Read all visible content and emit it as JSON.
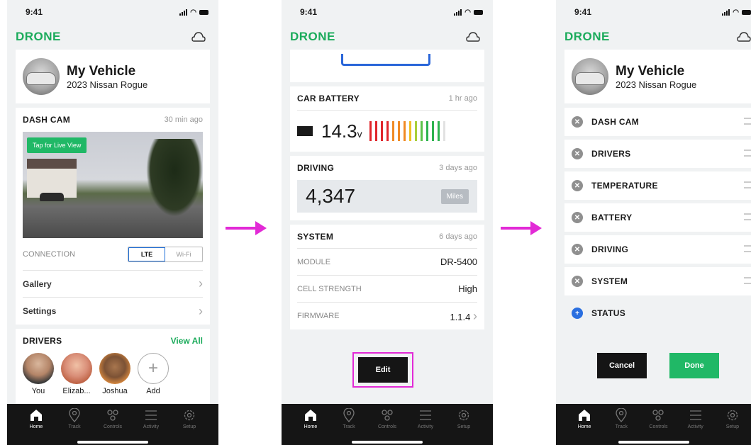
{
  "status_time": "9:41",
  "logo": "DRONE",
  "vehicle": {
    "title": "My Vehicle",
    "subtitle": "2023 Nissan Rogue"
  },
  "dash_cam": {
    "title": "DASH CAM",
    "time": "30 min ago",
    "live_label": "Tap for Live View",
    "connection_label": "CONNECTION",
    "options": [
      "LTE",
      "Wi-Fi"
    ],
    "selected": "LTE"
  },
  "links": {
    "gallery": "Gallery",
    "settings": "Settings"
  },
  "drivers": {
    "title": "DRIVERS",
    "view_all": "View All",
    "items": [
      {
        "name": "You",
        "color": "#c7a791"
      },
      {
        "name": "Elizab...",
        "color": "#d98e78"
      },
      {
        "name": "Joshua",
        "color": "#d9893e"
      }
    ],
    "add_label": "Add"
  },
  "battery": {
    "title": "CAR BATTERY",
    "time": "1 hr ago",
    "value": "14.3",
    "unit": "v",
    "level": 0.9
  },
  "driving": {
    "title": "DRIVING",
    "time": "3 days ago",
    "value": "4,347",
    "unit": "Miles"
  },
  "system": {
    "title": "SYSTEM",
    "time": "6 days ago",
    "rows": [
      {
        "label": "MODULE",
        "value": "DR-5400"
      },
      {
        "label": "CELL STRENGTH",
        "value": "High"
      },
      {
        "label": "FIRMWARE",
        "value": "1.1.4"
      }
    ]
  },
  "edit_label": "Edit",
  "edit_list": [
    "DASH CAM",
    "DRIVERS",
    "TEMPERATURE",
    "BATTERY",
    "DRIVING",
    "SYSTEM"
  ],
  "add_item": "STATUS",
  "cancel_label": "Cancel",
  "done_label": "Done",
  "tabs": [
    "Home",
    "Track",
    "Controls",
    "Activity",
    "Setup"
  ],
  "colors": {
    "brand": "#1bab5b",
    "arrow": "#e22ad6",
    "accent_blue": "#2a6fe0"
  }
}
